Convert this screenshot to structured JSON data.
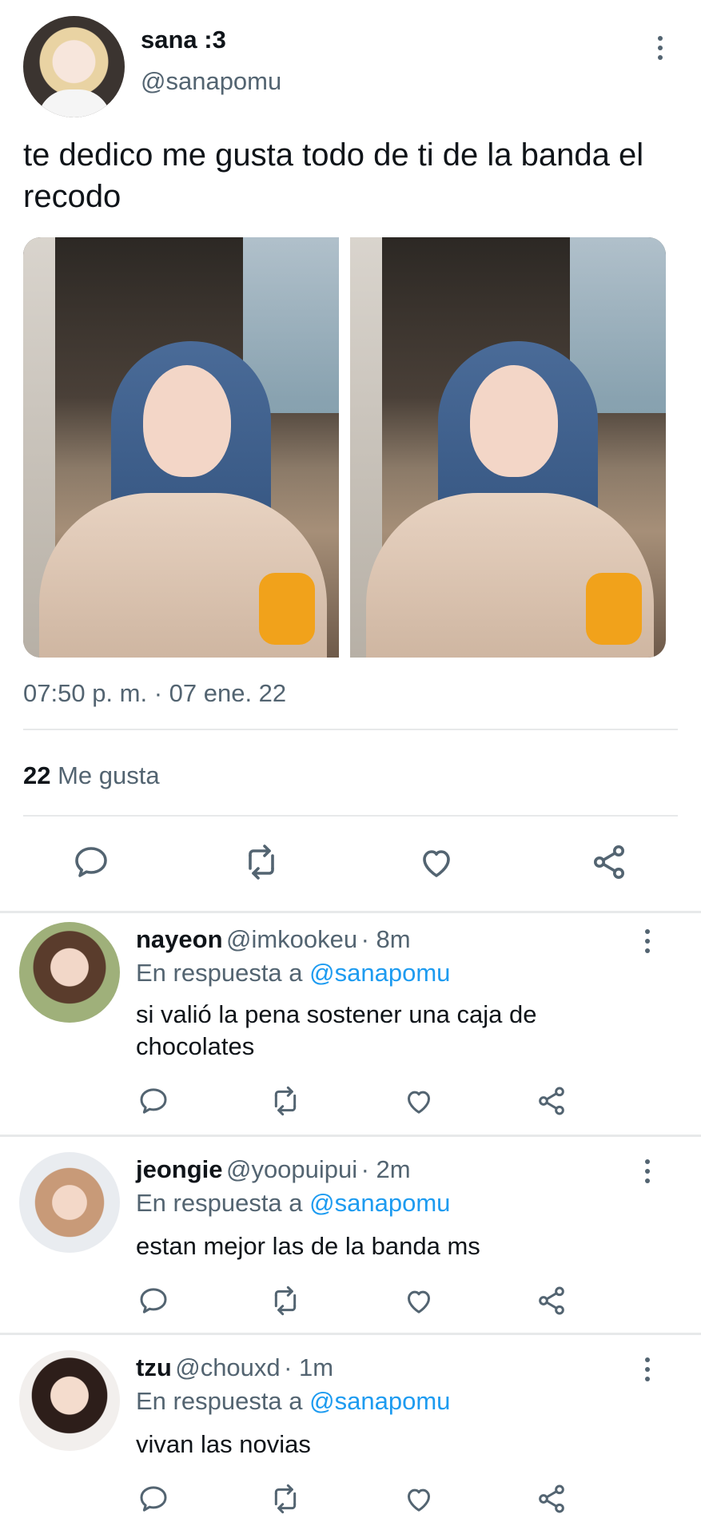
{
  "tweet": {
    "author_name": "sana :3",
    "author_handle": "@sanapomu",
    "text": "te dedico me gusta todo de ti de la banda el recodo",
    "timestamp": "07:50 p. m. · 07 ene. 22",
    "likes_count": "22",
    "likes_label": "Me gusta"
  },
  "icons": {
    "reply": "reply-icon",
    "retweet": "retweet-icon",
    "like": "heart-icon",
    "share": "share-icon",
    "more": "more-vertical-icon"
  },
  "colors": {
    "text": "#0f1419",
    "secondary": "#536471",
    "mention": "#1d9bf0",
    "divider": "#e7e9ea"
  },
  "replies": [
    {
      "name": "nayeon",
      "handle": "@imkookeu",
      "time": "· 8m",
      "reply_prefix": "En respuesta a",
      "reply_to": "@sanapomu",
      "text": "si valió la pena sostener una caja de chocolates"
    },
    {
      "name": "jeongie",
      "handle": "@yoopuipui",
      "time": "· 2m",
      "reply_prefix": "En respuesta a",
      "reply_to": "@sanapomu",
      "text": "estan mejor las de la banda ms"
    },
    {
      "name": "tzu",
      "handle": "@chouxd",
      "time": "· 1m",
      "reply_prefix": "En respuesta a",
      "reply_to": "@sanapomu",
      "text": "vivan las novias"
    }
  ]
}
